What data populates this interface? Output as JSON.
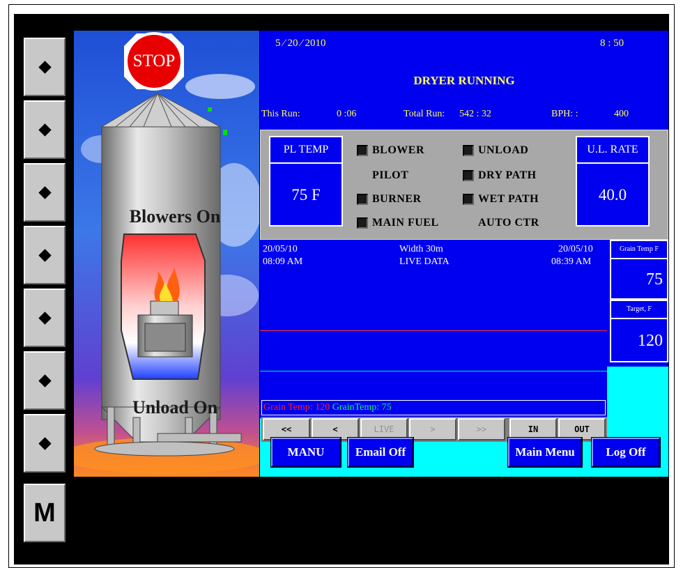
{
  "side_keys": [
    {
      "icon": "diamond-icon"
    },
    {
      "icon": "diamond-icon"
    },
    {
      "icon": "diamond-icon"
    },
    {
      "icon": "diamond-icon"
    },
    {
      "icon": "diamond-icon"
    },
    {
      "icon": "diamond-icon"
    },
    {
      "icon": "diamond-icon"
    }
  ],
  "menu_key": {
    "label": "M"
  },
  "silo": {
    "stop_label": "STOP",
    "blowers_text": "Blowers On",
    "unload_text": "Unload On"
  },
  "header": {
    "date": "5 ⁄ 20 ⁄ 2010",
    "time": "8 : 50",
    "status": "DRYER RUNNING",
    "this_run_label": "This Run:",
    "this_run_value": "0 :06",
    "total_run_label": "Total Run:",
    "total_run_value": "542 : 32",
    "bph_label": "BPH: :",
    "bph_value": "400"
  },
  "status_panel": {
    "pl_temp_label": "PL TEMP",
    "pl_temp_value": "75 F",
    "ul_rate_label": "U.L. RATE",
    "ul_rate_value": "40.0",
    "indicators_left": [
      {
        "label": "BLOWER",
        "led": true
      },
      {
        "label": "PILOT",
        "led": false
      },
      {
        "label": "BURNER",
        "led": true
      },
      {
        "label": "MAIN FUEL",
        "led": true
      }
    ],
    "indicators_right": [
      {
        "label": "UNLOAD",
        "led": true
      },
      {
        "label": "DRY PATH",
        "led": true
      },
      {
        "label": "WET PATH",
        "led": true
      },
      {
        "label": "AUTO CTR",
        "led": false
      }
    ]
  },
  "trend": {
    "start_date": "20/05/10",
    "start_time": "08:09 AM",
    "width_label": "Width 30m",
    "mode_label": "LIVE DATA",
    "end_date": "20/05/10",
    "end_time": "08:39 AM",
    "legend_red": "Grain Temp:  120",
    "legend_green": "GrainTemp:    75",
    "red_color": "#ff0000",
    "green_color": "#00ff66"
  },
  "readouts": {
    "grain_temp_label": "Grain Temp F",
    "grain_temp_value": "75",
    "target_label": "Target, F",
    "target_value": "120"
  },
  "nav_buttons": [
    "<<",
    "<",
    "LIVE",
    ">",
    ">>",
    "IN",
    "OUT"
  ],
  "actions": {
    "manu": "MANU",
    "email": "Email Off",
    "main_menu": "Main Menu",
    "log_off": "Log Off"
  }
}
